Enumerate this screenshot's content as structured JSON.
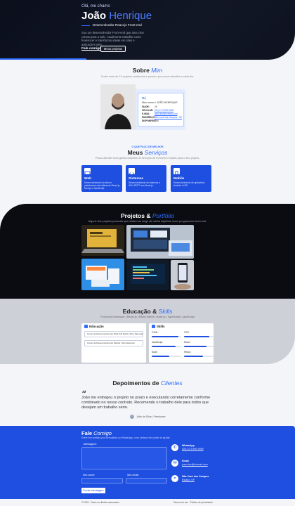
{
  "hero": {
    "greeting": "Olá, me chamo",
    "first_name": "João",
    "last_name": "Henrique",
    "role": "Desenvolvedor React.js Front-end",
    "description": "Sou um desenvolvedor Front-end que ama criar coisas para a web. Atualmente trabalho como freelancer e transformo ideias em sites e aplicações web.",
    "cta_primary": "Fale comigo",
    "cta_secondary": "Meus projetos"
  },
  "about": {
    "title": "Sobre",
    "title_accent": "Mim",
    "subtitle": "Tenho mais de 10 projetos realizados e procuro por novos desafios a cada dia.",
    "card": {
      "hello": "Oi,",
      "intro": "Meu nome é JOÃO HENRIQUE",
      "rows": [
        {
          "k": "IDADE:",
          "v": "25"
        },
        {
          "k": "CELULAR:",
          "v": "(00) 12 9.999-9999"
        },
        {
          "k": "E-MAIL:",
          "v": "joao.dev@hotmail.com"
        },
        {
          "k": "ENDEREÇO:",
          "v": "São José dos Campos - SP"
        },
        {
          "k": "DISPONÍVEL:",
          "v": "Sim"
        }
      ]
    }
  },
  "services": {
    "kicker": "O QUE FAÇO DE MELHOR",
    "title": "Meus",
    "title_accent": "Serviços",
    "subtitle": "Posso atender uma gama completa de serviços de front-end e bases para o seu projeto.",
    "items": [
      {
        "title": "Web",
        "desc": "Desenvolvimento de sites e plataformas web utilizando React.js, Next.js e JavaScript."
      },
      {
        "title": "Sistemas",
        "desc": "Desenvolvimento de sistemas e APIs REST com Node.js."
      },
      {
        "title": "Mobile",
        "desc": "Desenvolvimento de aplicativos Android e iOS."
      }
    ]
  },
  "projects": {
    "title": "Projetos &",
    "title_accent": "Portfólio",
    "subtitle": "Alguns dos projetos pessoais que realizei ao longo da minha trajetória como programador front-end."
  },
  "education": {
    "title": "Educação &",
    "title_accent": "Skills",
    "subtitle": "Front-end Developer | React.js | React Native | Node.js | TypeScript | JavaScript",
    "panel_title": "Educação",
    "courses": [
      "Curso de Desenvolvimento Web Full Stack | Dev Samurai",
      "Curso de Desenvolvimento Mobile | Dev Samurai"
    ],
    "skills_title": "Skills",
    "skills": [
      {
        "name": "HTML",
        "pct": 90
      },
      {
        "name": "CSS",
        "pct": 85
      },
      {
        "name": "JavaScript",
        "pct": 80
      },
      {
        "name": "React",
        "pct": 75
      },
      {
        "name": "Node",
        "pct": 60
      },
      {
        "name": "Redux",
        "pct": 65
      }
    ]
  },
  "testimonials": {
    "title": "Depoimentos de",
    "title_accent": "Clientes",
    "quote": "João me entregou o projeto no prazo e executando corretamente conforme combinado no nosso contrato. Recomendo o trabalho dele para todos que desejam um trabalho sério.",
    "author": "João da Silva",
    "author_role": "Freelancer"
  },
  "contact": {
    "title": "Fale",
    "title_accent": "Comigo",
    "subtitle": "Entre em contato por formulário ou WhatsApp, com certeza irei poder te ajudar.",
    "message_label": "Mensagem:",
    "name_label": "Seu nome:",
    "email_label": "Seu email:",
    "send": "Enviar mensagem",
    "info": [
      {
        "label": "WhatsApp",
        "value": "(00) 12 9.999-9999",
        "icon": "phone-icon"
      },
      {
        "label": "Email",
        "value": "joao.dev@hotmail.com",
        "icon": "mail-icon"
      },
      {
        "label": "São José dos Campos",
        "value": "Estado, SP",
        "icon": "location-icon"
      }
    ]
  },
  "footer": {
    "copyright": "© 2023 - Todos os direitos reservados.",
    "links": "Termos de uso  ·  Política de privacidade"
  },
  "colors": {
    "accent": "#2f6bff",
    "brand": "#1f4fe0",
    "dark": "#0b0f1c",
    "panel": "#cdd0d7"
  }
}
